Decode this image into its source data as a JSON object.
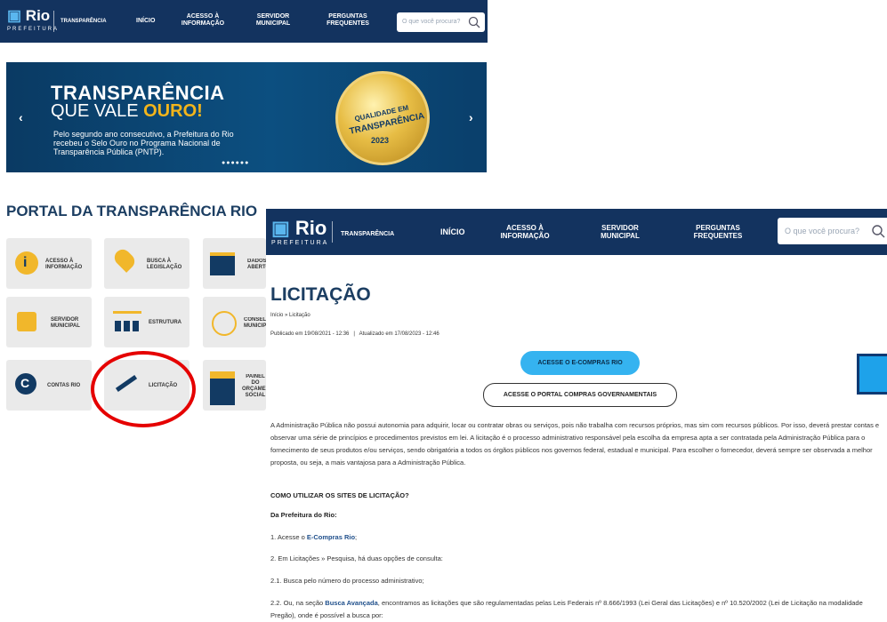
{
  "back": {
    "header": {
      "logo": "Rio",
      "logo_sub": "PREFEITURA",
      "portal": "TRANSPARÊNCIA",
      "nav": [
        "INÍCIO",
        "ACESSO À INFORMAÇÃO",
        "SERVIDOR MUNICIPAL",
        "PERGUNTAS FREQUENTES"
      ],
      "search_placeholder": "O que você procura?"
    },
    "banner": {
      "title1": "TRANSPARÊNCIA",
      "title2_pre": "QUE VALE ",
      "title2_em": "OURO!",
      "body": "Pelo segundo ano consecutivo, a Prefeitura do Rio recebeu o Selo Ouro no Programa Nacional de Transparência Pública (PNTP).",
      "medal_q": "QUALIDADE EM",
      "medal_t": "TRANSPARÊNCIA",
      "medal_y": "2023",
      "dots": "●●●●●●"
    },
    "portal_title": "PORTAL DA TRANSPARÊNCIA RIO",
    "cards": [
      "ACESSO À INFORMAÇÃO",
      "BUSCA À LEGISLAÇÃO",
      "DADOS ABERTOS",
      "SERVIDOR MUNICIPAL",
      "ESTRUTURA",
      "CONSELHOS MUNICIPAIS",
      "CONTAS RIO",
      "LICITAÇÃO",
      "PAINEL DO ORÇAMENTO SOCIAL"
    ]
  },
  "front": {
    "header": {
      "logo": "Rio",
      "logo_sub": "PREFEITURA",
      "portal": "TRANSPARÊNCIA",
      "nav": [
        "INÍCIO",
        "ACESSO À INFORMAÇÃO",
        "SERVIDOR MUNICIPAL",
        "PERGUNTAS FREQUENTES"
      ],
      "search_placeholder": "O que você procura?"
    },
    "title": "LICITAÇÃO",
    "breadcrumb": "Início » Licitação",
    "published": "Publicado em 19/08/2021 - 12:36   |   Atualizado em 17/08/2023 - 12:46",
    "btn_ecompras": "ACESSE O E-COMPRAS RIO",
    "btn_portal": "ACESSE O PORTAL COMPRAS GOVERNAMENTAIS",
    "intro": "A Administração Pública não possui autonomia para adquirir, locar ou contratar obras ou serviços, pois não trabalha com recursos próprios, mas sim com recursos públicos. Por isso, deverá prestar contas e observar uma série de princípios e procedimentos previstos em lei. A licitação é o processo administrativo responsável pela escolha da empresa apta a ser contratada pela Administração Pública para o fornecimento de seus produtos e/ou serviços, sendo obrigatória a todos os órgãos públicos nos governos federal, estadual e municipal. Para escolher o fornecedor, deverá sempre ser observada a melhor proposta, ou seja, a mais vantajosa para a Administração Pública.",
    "how_title": "COMO UTILIZAR OS SITES DE LICITAÇÃO?",
    "prefeitura_title": "Da Prefeitura do Rio:",
    "step1_pre": "1. Acesse o ",
    "step1_link": "E-Compras Rio",
    "step1_post": ";",
    "step2": "2. Em Licitações » Pesquisa, há duas opções de consulta:",
    "step21": "2.1. Busca pelo número do processo administrativo;",
    "step22_pre": "2.2. Ou, na seção ",
    "step22_link": "Busca Avançada",
    "step22_post": ", encontramos as licitações que são regulamentadas pelas Leis Federais nº 8.666/1993 (Lei Geral das Licitações) e nº 10.520/2002 (Lei de Licitação na modalidade Pregão), onde é possível a busca por:"
  }
}
